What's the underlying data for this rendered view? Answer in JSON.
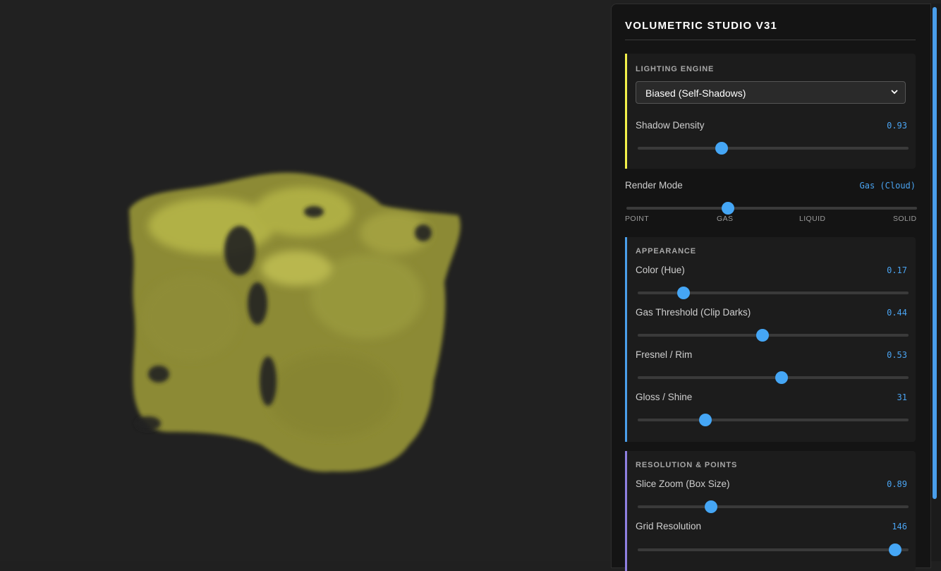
{
  "panel": {
    "title": "VOLUMETRIC STUDIO V31",
    "accent": "#45a6f5"
  },
  "lighting": {
    "heading": "LIGHTING ENGINE",
    "bar_color": "#f2f04a",
    "engine_select": {
      "selected": "Biased (Self-Shadows)"
    },
    "shadow_density": {
      "label": "Shadow Density",
      "value": "0.93",
      "fraction": 0.31
    }
  },
  "render_mode": {
    "label": "Render Mode",
    "value": "Gas (Cloud)",
    "fraction": 0.35,
    "ticks": [
      "POINT",
      "GAS",
      "LIQUID",
      "SOLID"
    ]
  },
  "appearance": {
    "heading": "APPEARANCE",
    "bar_color": "#4a9eea",
    "controls": [
      {
        "label": "Color (Hue)",
        "value": "0.17",
        "fraction": 0.17
      },
      {
        "label": "Gas Threshold (Clip Darks)",
        "value": "0.44",
        "fraction": 0.46
      },
      {
        "label": "Fresnel / Rim",
        "value": "0.53",
        "fraction": 0.53
      },
      {
        "label": "Gloss / Shine",
        "value": "31",
        "fraction": 0.25
      }
    ]
  },
  "resolution": {
    "heading": "RESOLUTION & POINTS",
    "bar_color": "#8f7fe0",
    "controls": [
      {
        "label": "Slice Zoom (Box Size)",
        "value": "0.89",
        "fraction": 0.27
      },
      {
        "label": "Grid Resolution",
        "value": "146",
        "fraction": 0.95
      }
    ]
  },
  "viewport": {
    "volume_color": "#a8a83a"
  }
}
